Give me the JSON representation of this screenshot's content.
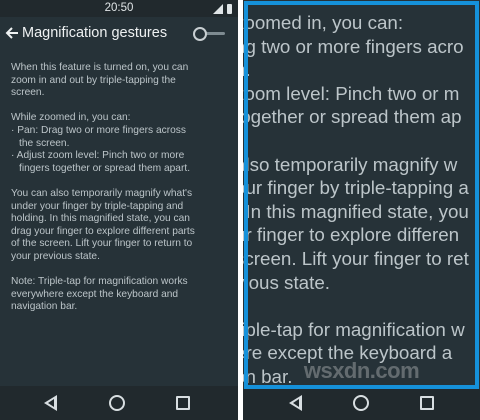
{
  "status_bar": {
    "time": "20:50",
    "signal_icon": "signal-icon",
    "battery_icon": "battery-icon"
  },
  "action_bar": {
    "back_icon": "back-arrow-icon",
    "title": "Magnification gestures",
    "toggle": {
      "state": "off"
    }
  },
  "content": {
    "p1": [
      "When this feature is turned on, you can",
      "zoom in and out by triple-tapping the",
      "screen."
    ],
    "p2_heading": "While zoomed in, you can:",
    "p2_items": [
      [
        "· Pan: Drag two or more fingers across",
        "the screen."
      ],
      [
        "· Adjust zoom level: Pinch two or more",
        "fingers together or spread them apart."
      ]
    ],
    "p3": [
      "You can also temporarily magnify what's",
      "under your finger by triple-tapping and",
      "holding. In this magnified state, you can",
      "drag your finger to explore different parts",
      "of the screen. Lift your finger to return to",
      "your previous state."
    ],
    "p4": [
      "Note: Triple-tap for magnification works",
      "everywhere except the keyboard and",
      "navigation bar."
    ]
  },
  "zoomed_view": {
    "lines": [
      "zoomed in, you can:",
      "ag two or more fingers acro",
      "n.",
      "zoom level: Pinch two or m",
      "together or spread them ap",
      "",
      "also temporarily magnify w",
      "our finger by triple-tapping a",
      ". In this magnified state, you",
      "ur finger to explore differen",
      "screen. Lift your finger to ret",
      "vious state.",
      "",
      "riple-tap for magnification w",
      "ere except the keyboard a",
      "on bar."
    ],
    "watermark": "wsxdn.com",
    "border_color": "#1591da"
  },
  "navigation_bar": {
    "back_icon": "nav-back-icon",
    "home_icon": "nav-home-icon",
    "recents_icon": "nav-recents-icon"
  }
}
